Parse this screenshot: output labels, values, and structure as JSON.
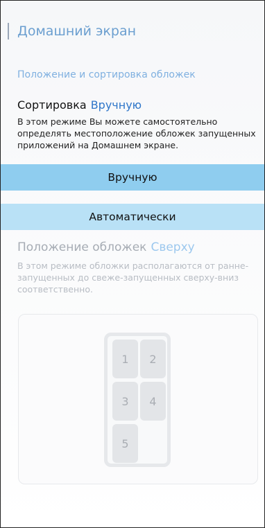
{
  "header": {
    "title": "Домашний экран"
  },
  "section": {
    "label": "Положение и сортировка обложек"
  },
  "sorting": {
    "label": "Сортировка",
    "value": "Вручную",
    "description": "В этом режиме Вы можете самостоятельно определять местоположение обложек запущенных приложений на Домашнем экране."
  },
  "options": [
    {
      "label": "Вручную",
      "selected": true
    },
    {
      "label": "Автоматически",
      "selected": false
    }
  ],
  "position": {
    "label": "Положение обложек",
    "value": "Сверху",
    "description": "В этом режиме обложки располагаются от ранне-запущенных до свеже-запущенных сверху-вниз соответственно."
  },
  "preview": {
    "tiles": [
      "1",
      "2",
      "3",
      "4",
      "5"
    ]
  },
  "colors": {
    "accent": "#2f76c9",
    "option_selected": "#8fcdef",
    "option_other": "#b9e1f6"
  }
}
